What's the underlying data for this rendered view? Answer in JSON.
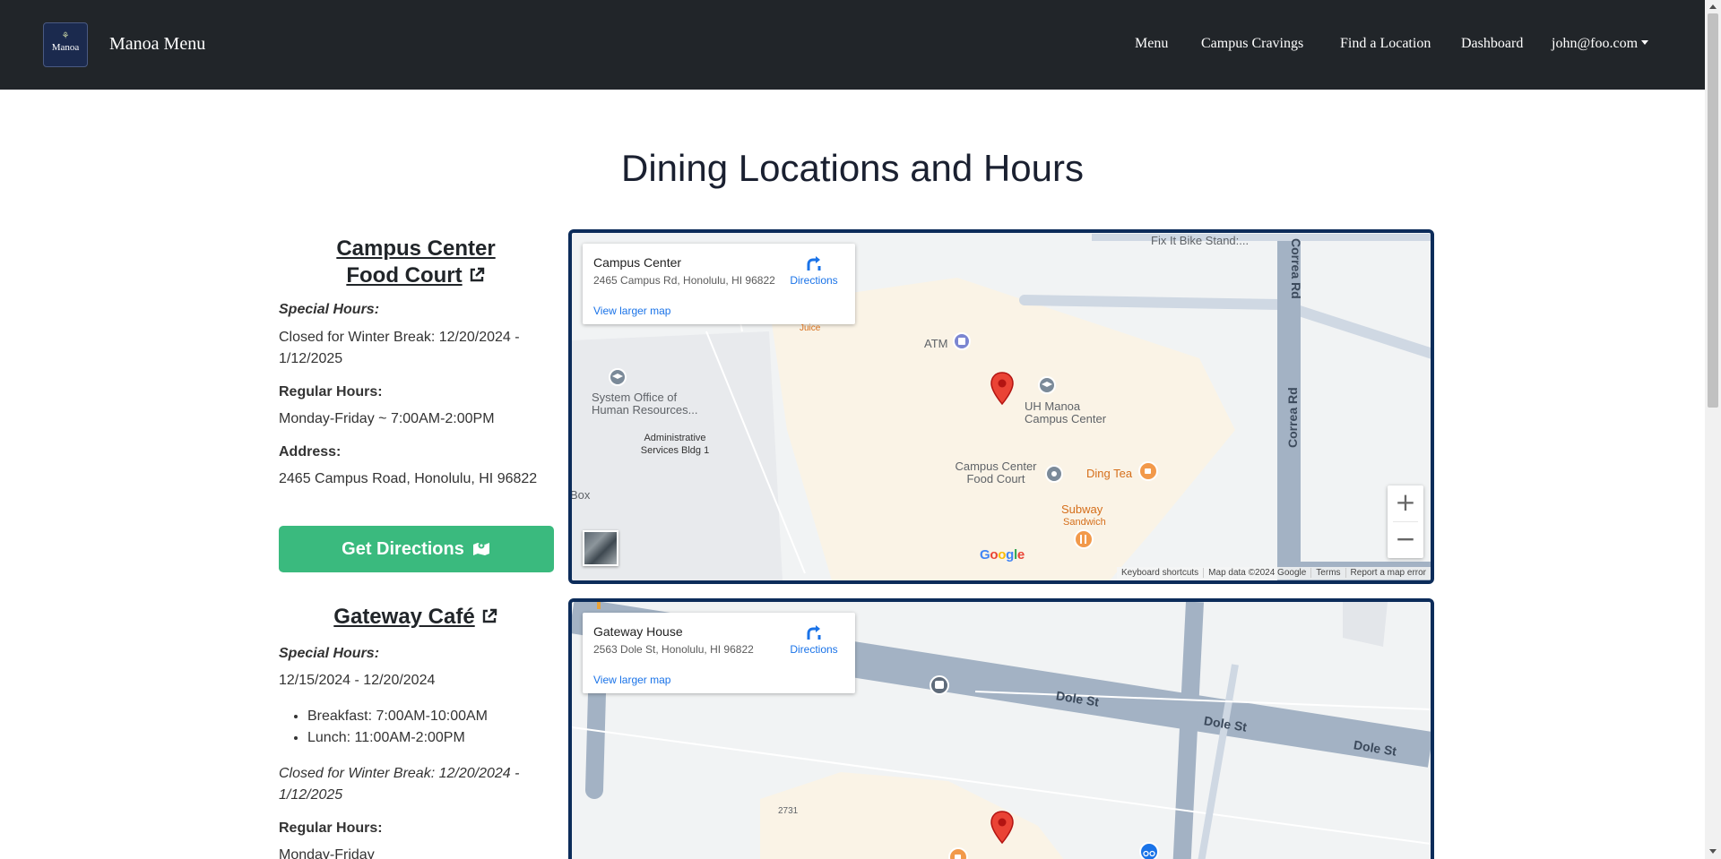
{
  "navbar": {
    "brand_logo_text": "Manoa",
    "brand_name": "Manoa Menu",
    "links": [
      "Menu",
      "Campus Cravings",
      "Find a Location",
      "Dashboard"
    ],
    "user_email": "john@foo.com"
  },
  "page": {
    "title": "Dining Locations and Hours"
  },
  "locations": [
    {
      "title_line1": "Campus Center",
      "title_line2": "Food Court",
      "special_hours_label": "Special Hours:",
      "special_hours_text": "Closed for Winter Break: 12/20/2024 - 1/12/2025",
      "regular_hours_label": "Regular Hours:",
      "regular_hours_text": "Monday-Friday ~ 7:00AM-2:00PM",
      "address_label": "Address:",
      "address_text": "2465 Campus Road, Honolulu, HI 96822",
      "directions_button": "Get Directions",
      "map": {
        "place_name": "Campus Center",
        "place_address": "2465 Campus Rd, Honolulu, HI 96822",
        "directions_label": "Directions",
        "larger_map_label": "View larger map",
        "labels": {
          "fix_it": "Fix It Bike Stand:...",
          "correa_top": "Correa Rd",
          "correa_mid": "Correa Rd",
          "juice": "Juice",
          "atm": "ATM",
          "system_office": "System Office of Human Resources...",
          "admin_bldg": "Administrative Services Bldg 1",
          "uh_manoa": "UH Manoa Campus Center",
          "food_court": "Campus Center Food Court",
          "ding_tea": "Ding Tea",
          "subway": "Subway",
          "sandwich": "Sandwich",
          "box": "Box"
        },
        "footer": [
          "Keyboard shortcuts",
          "Map data ©2024 Google",
          "Terms",
          "Report a map error"
        ],
        "google_logo": "Google",
        "zoom_in": "+",
        "zoom_out": "−"
      }
    },
    {
      "title": "Gateway Café",
      "special_hours_label": "Special Hours:",
      "special_hours_range": "12/15/2024 - 12/20/2024",
      "meals": [
        "Breakfast: 7:00AM-10:00AM",
        "Lunch: 11:00AM-2:00PM"
      ],
      "closed_text": "Closed for Winter Break: 12/20/2024 - 1/12/2025",
      "regular_hours_label": "Regular Hours:",
      "regular_hours_text": "Monday-Friday",
      "map": {
        "place_name": "Gateway House",
        "place_address": "2563 Dole St, Honolulu, HI 96822",
        "directions_label": "Directions",
        "larger_map_label": "View larger map",
        "labels": {
          "dole1": "Dole St",
          "dole2": "Dole St",
          "dole3": "Dole St",
          "num_2731": "2731"
        }
      }
    }
  ],
  "colors": {
    "navbar": "#212529",
    "map_border": "#0c2c5a",
    "directions_button": "#3aba7e",
    "link_blue": "#1a73e8"
  }
}
